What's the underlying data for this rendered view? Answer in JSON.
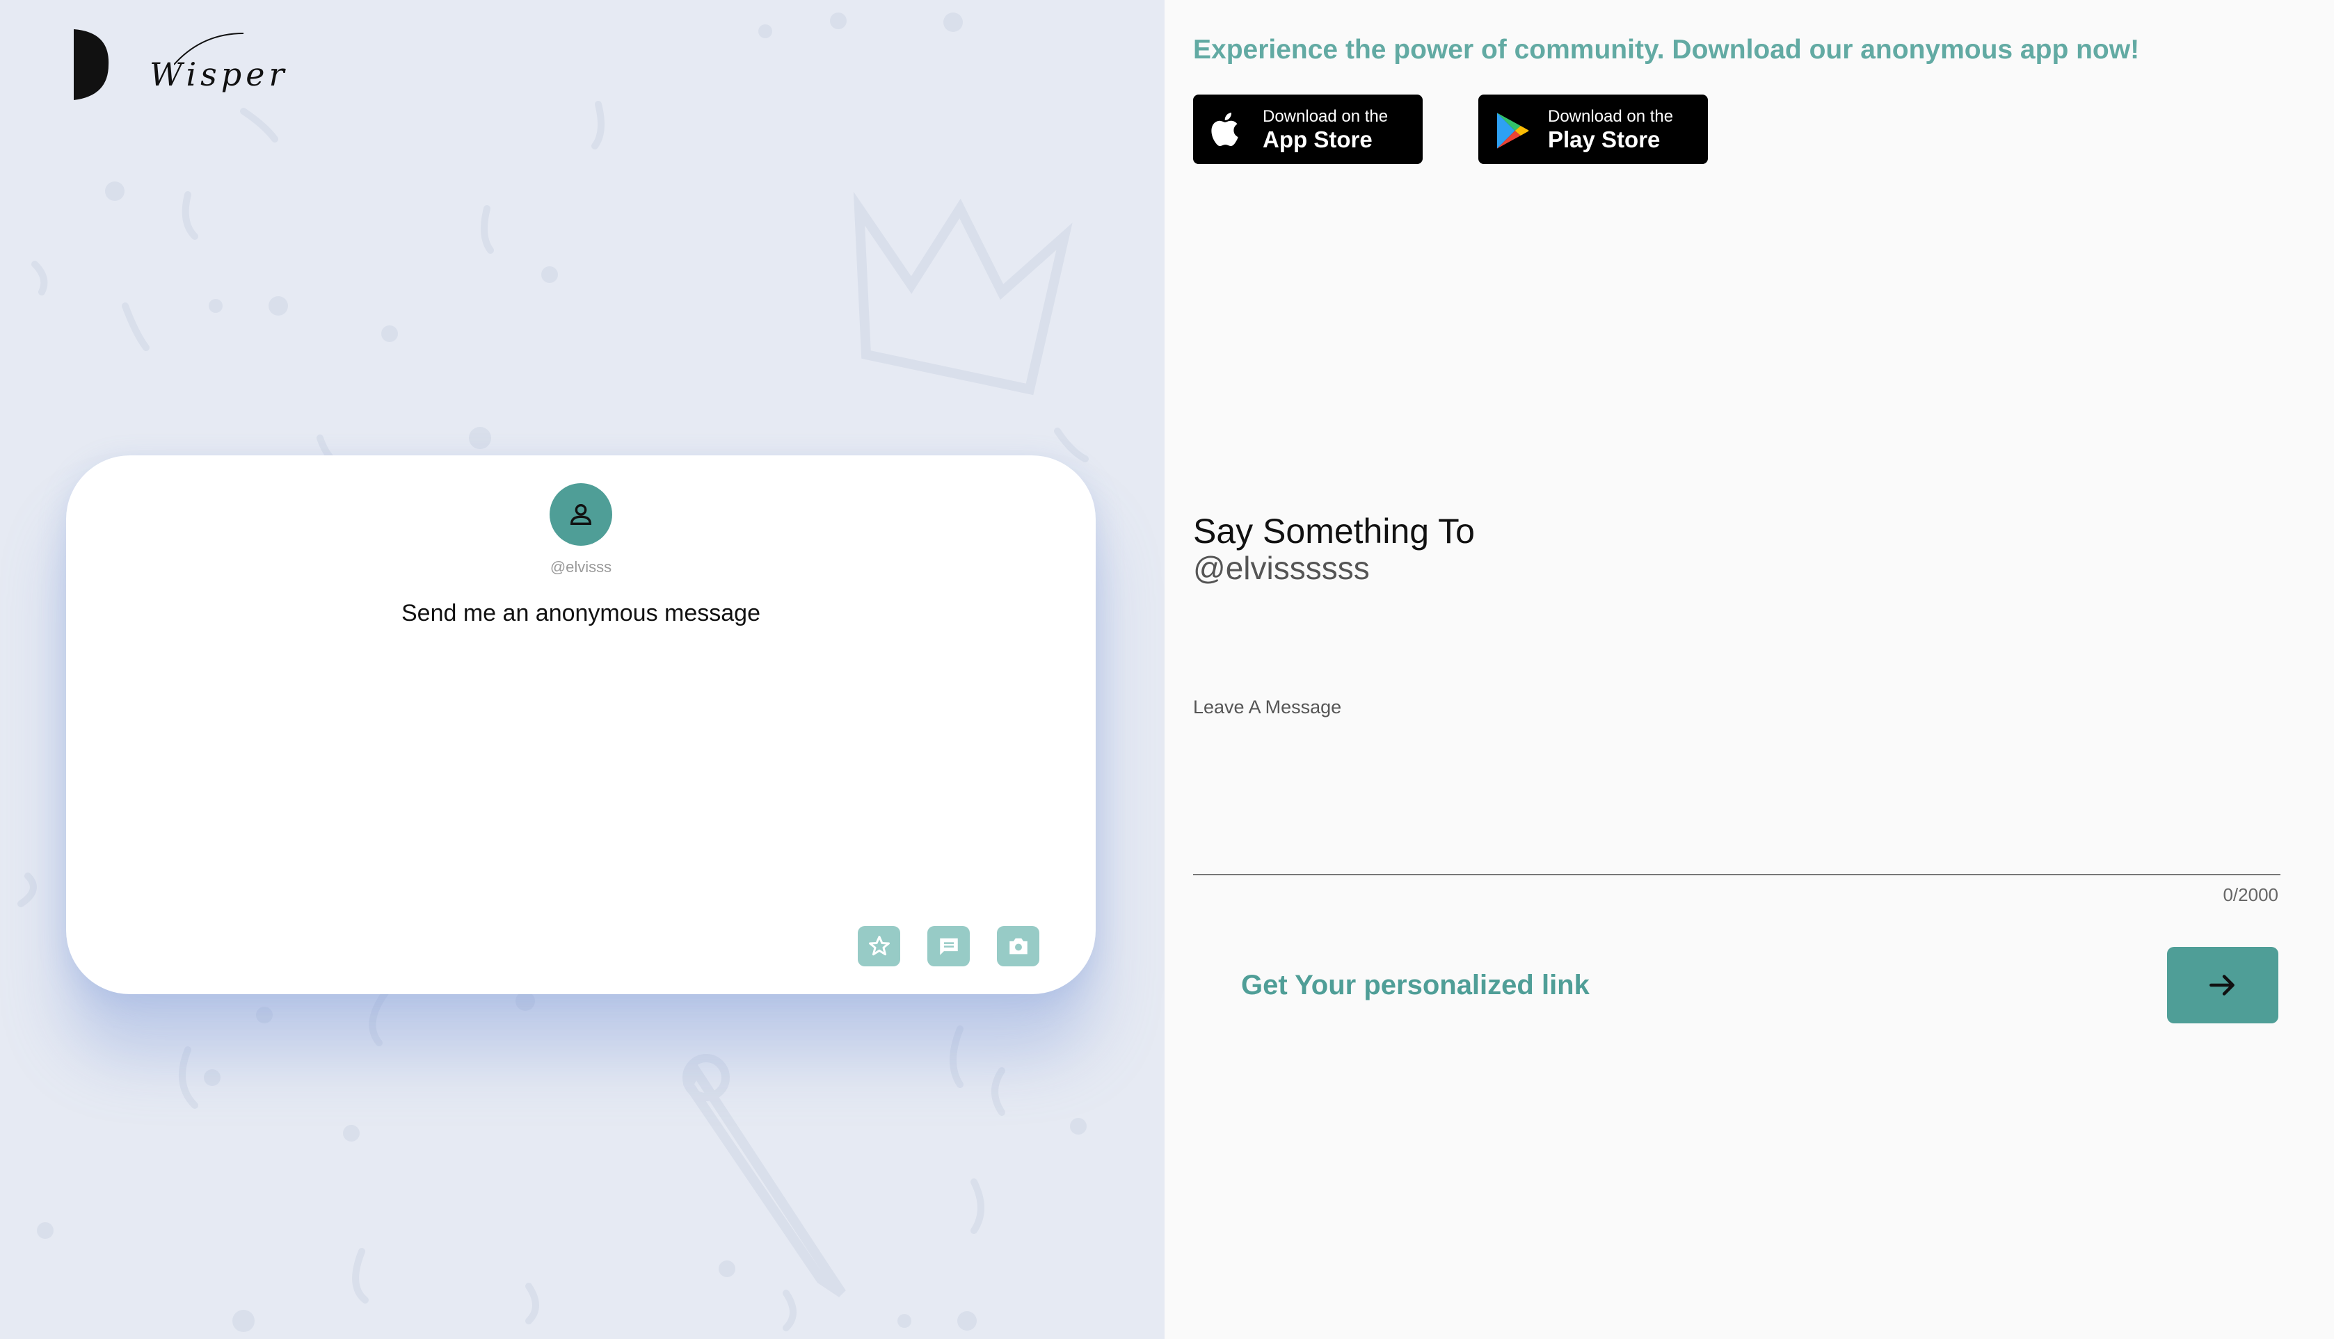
{
  "brand": {
    "name": "Wisper"
  },
  "profile_card": {
    "handle": "@elvisss",
    "prompt": "Send me an anonymous message",
    "actions": [
      {
        "icon": "star-icon"
      },
      {
        "icon": "chat-icon"
      },
      {
        "icon": "camera-icon"
      }
    ]
  },
  "promo": {
    "headline": "Experience the power of community. Download our anonymous app now!",
    "app_store": {
      "small": "Download on the",
      "big": "App Store"
    },
    "play_store": {
      "small": "Download on the",
      "big": "Play Store"
    }
  },
  "compose": {
    "title": "Say Something To",
    "recipient": "@elvissssss",
    "label": "Leave A Message",
    "value": "",
    "char_count": "0/2000"
  },
  "cta": {
    "label": "Get Your personalized link"
  },
  "colors": {
    "accent": "#4f9e97",
    "accent_light": "#97cbc6",
    "headline": "#62aaa3",
    "left_background": "#e6eaf3"
  }
}
